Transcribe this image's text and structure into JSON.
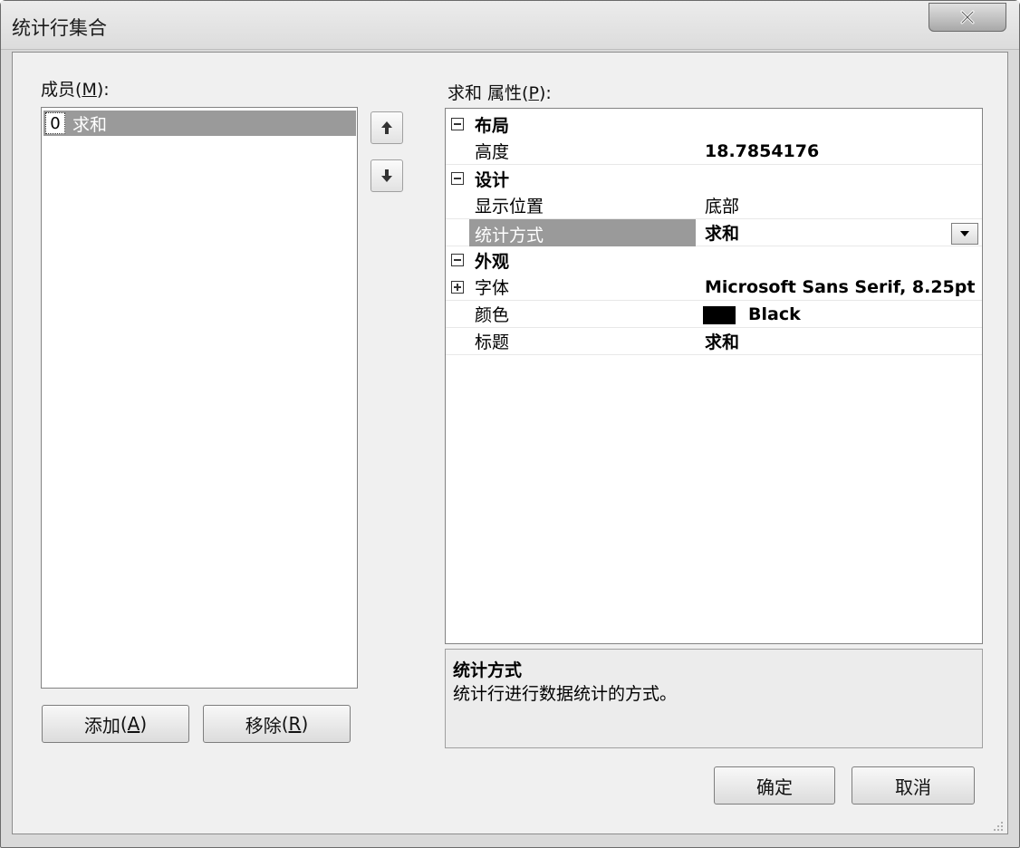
{
  "window": {
    "title": "统计行集合",
    "close_label": "X"
  },
  "members": {
    "label_prefix": "成员",
    "label_key": "M",
    "items": [
      {
        "index": "0",
        "text": "求和"
      }
    ]
  },
  "buttons": {
    "add_prefix": "添加",
    "add_key": "A",
    "remove_prefix": "移除",
    "remove_key": "R",
    "ok": "确定",
    "cancel": "取消"
  },
  "properties": {
    "label_prefix": "求和 属性",
    "label_key": "P",
    "categories": {
      "layout": "布局",
      "design": "设计",
      "appearance": "外观"
    },
    "rows": {
      "height": {
        "name": "高度",
        "value": "18.7854176"
      },
      "display_position": {
        "name": "显示位置",
        "value": "底部"
      },
      "stat_method": {
        "name": "统计方式",
        "value": "求和"
      },
      "font": {
        "name": "字体",
        "value": "Microsoft Sans Serif, 8.25pt"
      },
      "color": {
        "name": "颜色",
        "value": "Black",
        "swatch": "#000000"
      },
      "caption": {
        "name": "标题",
        "value": "求和"
      }
    }
  },
  "description": {
    "title": "统计方式",
    "text": "统计行进行数据统计的方式。"
  },
  "colors": {
    "selection": "#9a9a9a",
    "dialog_bg": "#f0f0f0"
  }
}
